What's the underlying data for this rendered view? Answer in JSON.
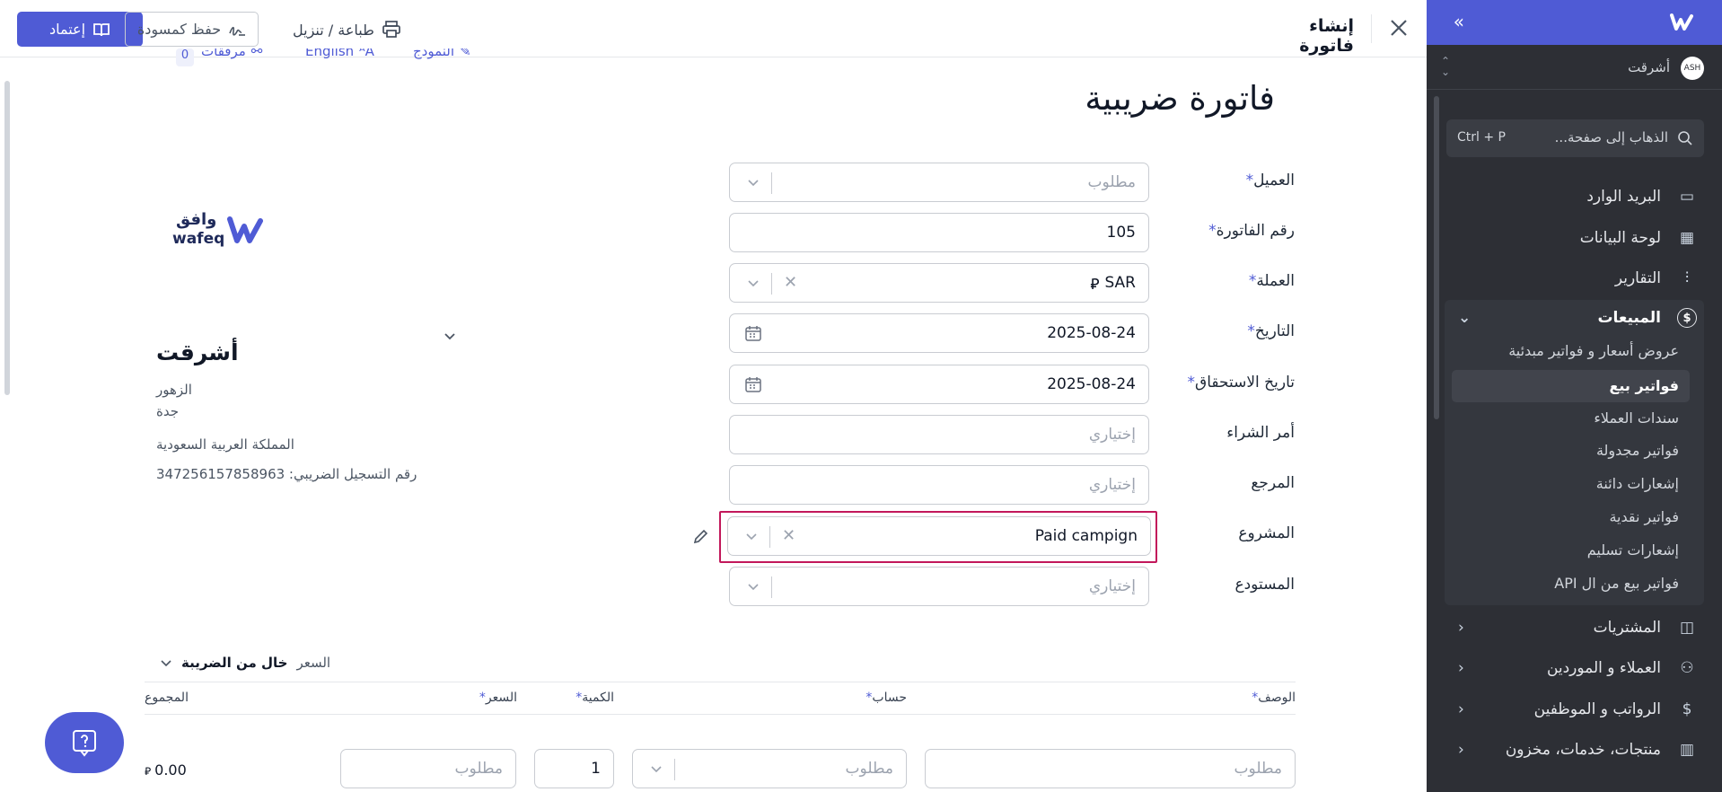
{
  "sidebar": {
    "company": "أشرقت",
    "avatar": "ASH",
    "search_placeholder": "الذهاب إلى صفحة...",
    "search_shortcut": "Ctrl + P",
    "items": [
      {
        "label": "البريد الوارد",
        "icon": "inbox-icon"
      },
      {
        "label": "لوحة البيانات",
        "icon": "dashboard-icon"
      },
      {
        "label": "التقارير",
        "icon": "chart-icon"
      },
      {
        "label": "المبيعات",
        "icon": "dollar-circle-icon"
      },
      {
        "label": "المشتريات",
        "icon": "bag-icon"
      },
      {
        "label": "العملاء و الموردين",
        "icon": "users-icon"
      },
      {
        "label": "الرواتب و الموظفين",
        "icon": "payroll-icon"
      },
      {
        "label": "منتجات، خدمات، مخزون",
        "icon": "barcode-icon"
      }
    ],
    "sales_sub": [
      "عروض أسعار و فواتير مبدئية",
      "فواتير بيع",
      "سندات العملاء",
      "فواتير مجدولة",
      "إشعارات دائنة",
      "فواتير نقدية",
      "إشعارات تسليم",
      "فواتير بيع من ال API"
    ]
  },
  "topbar": {
    "title": "إنشاء فاتورة",
    "print": "طباعة / تنزيل",
    "draft": "حفظ كمسودة",
    "approve": "إعتماد"
  },
  "subbar": {
    "template": "النموذج",
    "language": "English",
    "attachments": "مرفقات",
    "attachments_count": "0"
  },
  "doc_title": "فاتورة ضريبية",
  "logo": {
    "ar": "وافق",
    "en": "wafeq"
  },
  "company_box": {
    "name": "أشرقت",
    "line1": "الزهور",
    "line2": "جدة",
    "country": "المملكة العربية السعودية",
    "vat": "رقم التسجيل الضريبي: 347256157858963"
  },
  "form": {
    "customer": {
      "label": "العميل",
      "placeholder": "مطلوب"
    },
    "invoice_no": {
      "label": "رقم الفاتورة",
      "value": "105"
    },
    "currency": {
      "label": "العملة",
      "value": "SAR"
    },
    "date": {
      "label": "التاريخ",
      "value": "2025-08-24"
    },
    "due_date": {
      "label": "تاريخ الاستحقاق",
      "value": "2025-08-24"
    },
    "po": {
      "label": "أمر الشراء",
      "placeholder": "إختياري"
    },
    "reference": {
      "label": "المرجع",
      "placeholder": "إختياري"
    },
    "project": {
      "label": "المشروع",
      "value": "Paid campign"
    },
    "warehouse": {
      "label": "المستودع",
      "placeholder": "إختياري"
    }
  },
  "price_toggle": {
    "prefix": "السعر",
    "value": "خال من الضريبة"
  },
  "table": {
    "headers": {
      "description": "الوصف",
      "account": "حساب",
      "quantity": "الكمية",
      "price": "السعر",
      "total": "المجموع"
    },
    "row": {
      "description_ph": "مطلوب",
      "account_ph": "مطلوب",
      "quantity": "1",
      "price_ph": "مطلوب",
      "total": "0.00"
    }
  },
  "colors": {
    "accent": "#4f5bd5",
    "sidebar_bg": "#2d2f35",
    "highlight_border": "#c2185b"
  }
}
